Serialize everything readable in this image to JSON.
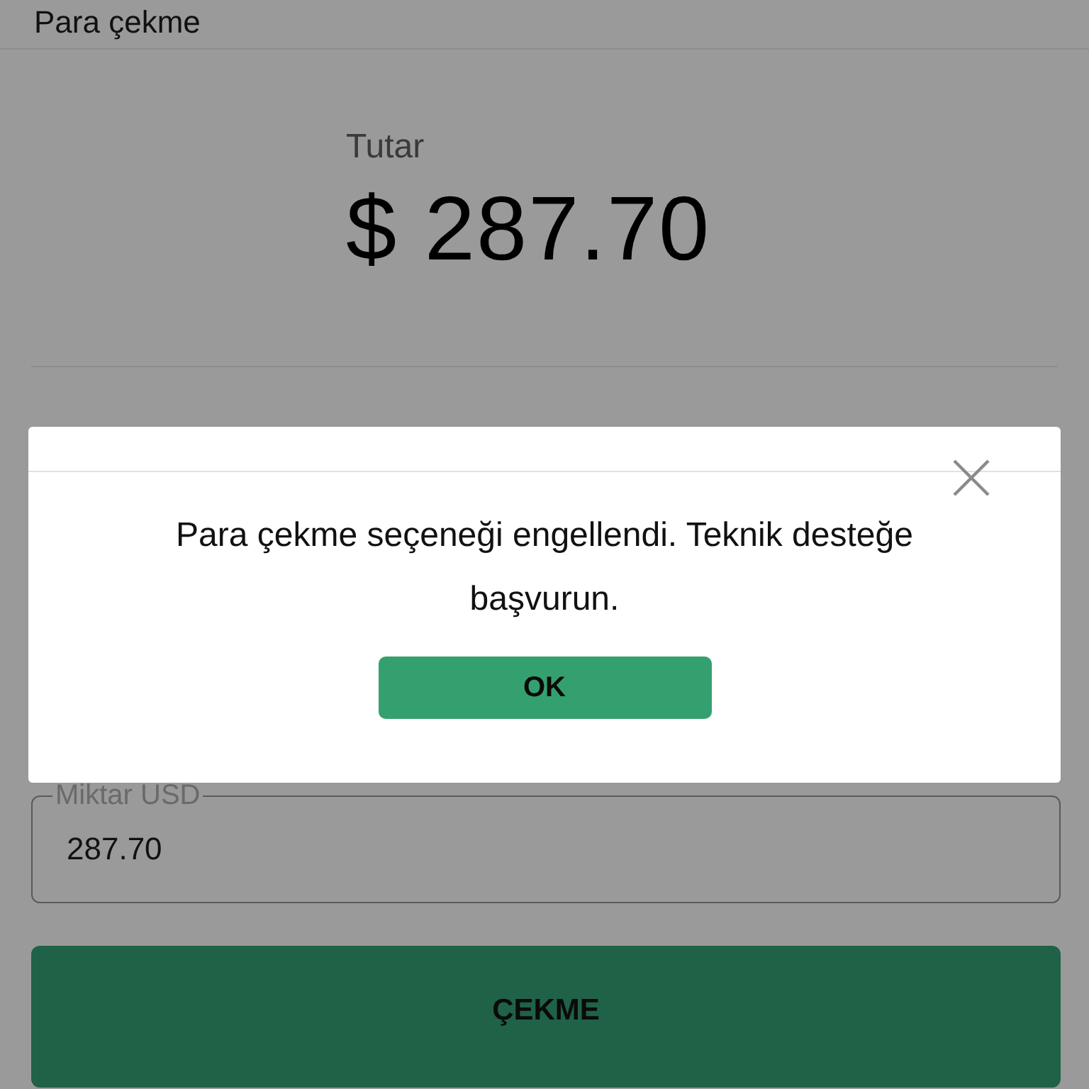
{
  "header": {
    "title": "Para çekme"
  },
  "balance": {
    "label": "Tutar",
    "amount": "$ 287.70"
  },
  "amount_field": {
    "label": "Miktar USD",
    "value": "287.70"
  },
  "submit_button": {
    "label": "ÇEKME"
  },
  "dialog": {
    "message": "Para çekme seçeneği engellendi. Teknik desteğe başvurun.",
    "button": "OK"
  }
}
